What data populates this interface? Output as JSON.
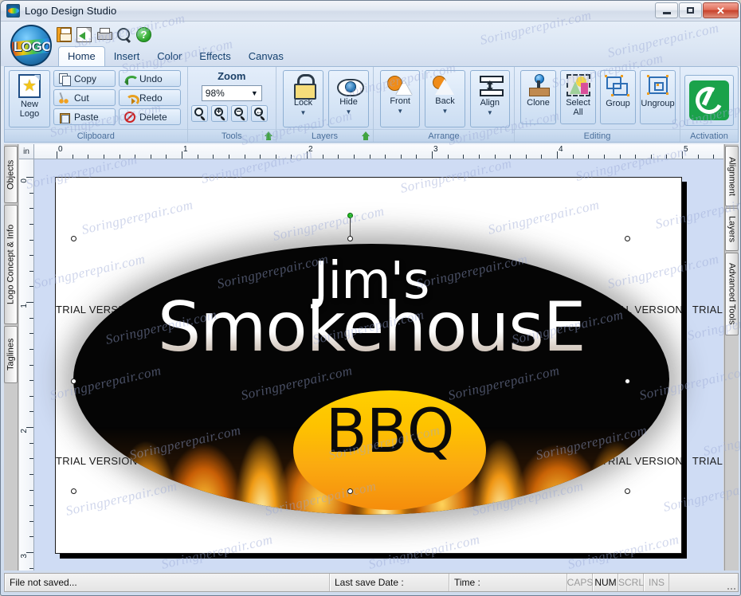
{
  "window": {
    "title": "Logo Design Studio",
    "app_icon": "logo-app-icon",
    "buttons": {
      "minimize": "Minimize",
      "maximize": "Maximize",
      "close": "Close"
    }
  },
  "quick_access": [
    {
      "name": "save-icon",
      "label": "Save"
    },
    {
      "name": "export-icon",
      "label": "Export"
    },
    {
      "name": "print-icon",
      "label": "Print"
    },
    {
      "name": "preview-icon",
      "label": "Preview"
    },
    {
      "name": "help-icon",
      "label": "Help",
      "glyph": "?"
    }
  ],
  "tabs": [
    {
      "label": "Home",
      "active": true
    },
    {
      "label": "Insert",
      "active": false
    },
    {
      "label": "Color",
      "active": false
    },
    {
      "label": "Effects",
      "active": false
    },
    {
      "label": "Canvas",
      "active": false
    }
  ],
  "ribbon": {
    "clipboard": {
      "group_label": "Clipboard",
      "new_logo": {
        "line1": "New",
        "line2": "Logo"
      },
      "buttons": [
        {
          "label": "Copy",
          "icon": "copy-icon"
        },
        {
          "label": "Cut",
          "icon": "cut-icon"
        },
        {
          "label": "Paste",
          "icon": "paste-icon"
        },
        {
          "label": "Undo",
          "icon": "undo-icon"
        },
        {
          "label": "Redo",
          "icon": "redo-icon"
        },
        {
          "label": "Delete",
          "icon": "delete-icon"
        }
      ]
    },
    "tools": {
      "group_label": "Tools",
      "zoom_title": "Zoom",
      "zoom_value": "98%",
      "zoom_buttons": [
        {
          "name": "zoom-window-button",
          "sym": ""
        },
        {
          "name": "zoom-in-button",
          "sym": "+"
        },
        {
          "name": "zoom-out-button",
          "sym": "−"
        },
        {
          "name": "zoom-fit-button",
          "sym": "↔"
        }
      ]
    },
    "layers": {
      "group_label": "Layers",
      "buttons": [
        {
          "label": "Lock",
          "icon": "lock-icon",
          "caret": "▼"
        },
        {
          "label": "Hide",
          "icon": "eye-icon",
          "caret": "▼"
        }
      ]
    },
    "arrange": {
      "group_label": "Arrange",
      "buttons": [
        {
          "label": "Front",
          "icon": "bring-front-icon",
          "caret": "▼"
        },
        {
          "label": "Back",
          "icon": "send-back-icon",
          "caret": "▼"
        },
        {
          "label": "Align",
          "icon": "align-icon",
          "caret": "▼"
        }
      ]
    },
    "editing": {
      "group_label": "Editing",
      "buttons": [
        {
          "label": "Clone",
          "icon": "clone-icon"
        },
        {
          "label": "Select All",
          "line1": "Select",
          "line2": "All",
          "icon": "select-all-icon"
        },
        {
          "label": "Group",
          "icon": "group-icon"
        },
        {
          "label": "Ungroup",
          "icon": "ungroup-icon"
        }
      ]
    },
    "activation": {
      "group_label": "Activation",
      "button": {
        "label": "Activate",
        "icon": "activation-check-icon"
      }
    }
  },
  "panels": {
    "left_tabs": [
      {
        "label": "Objects"
      },
      {
        "label": "Logo Concept & Info"
      },
      {
        "label": "Taglines"
      }
    ],
    "right_tabs": [
      {
        "label": "Alignment"
      },
      {
        "label": "Layers"
      },
      {
        "label": "Advanced Tools"
      }
    ]
  },
  "rulers": {
    "unit": "in",
    "horizontal_labels": [
      "0",
      "1",
      "2",
      "3",
      "4",
      "5"
    ],
    "vertical_labels": [
      "0",
      "1",
      "2",
      "3"
    ]
  },
  "canvas": {
    "watermark_text": "TRIAL VERSION",
    "site_watermark": "Soringperepair.com",
    "logo": {
      "line1": "Jim's",
      "line2": "SmokehousE",
      "line3": "BBQ"
    },
    "colors": {
      "ellipse": "#050505",
      "badge_top": "#ffd000",
      "badge_bottom": "#f58d0c",
      "flame_hot": "#fff0a0",
      "flame_mid": "#e88c10",
      "text": "#ffffff"
    }
  },
  "statusbar": {
    "file_status": "File not saved...",
    "last_save_label": "Last save Date :",
    "time_label": "Time :",
    "indicators": [
      {
        "label": "CAPS",
        "active": false
      },
      {
        "label": "NUM",
        "active": true
      },
      {
        "label": "SCRL",
        "active": false
      },
      {
        "label": "INS",
        "active": false
      }
    ]
  }
}
